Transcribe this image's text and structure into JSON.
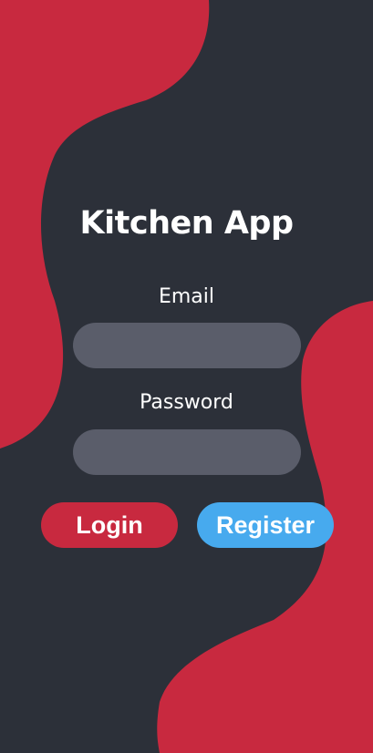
{
  "app": {
    "title": "Kitchen App"
  },
  "form": {
    "email_label": "Email",
    "email_value": "",
    "password_label": "Password",
    "password_value": ""
  },
  "buttons": {
    "login_label": "Login",
    "register_label": "Register"
  },
  "colors": {
    "background": "#2c3039",
    "accent_red": "#c8293f",
    "accent_blue": "#47aaee",
    "input_fill": "#5a5d6a",
    "text": "#ffffff"
  }
}
